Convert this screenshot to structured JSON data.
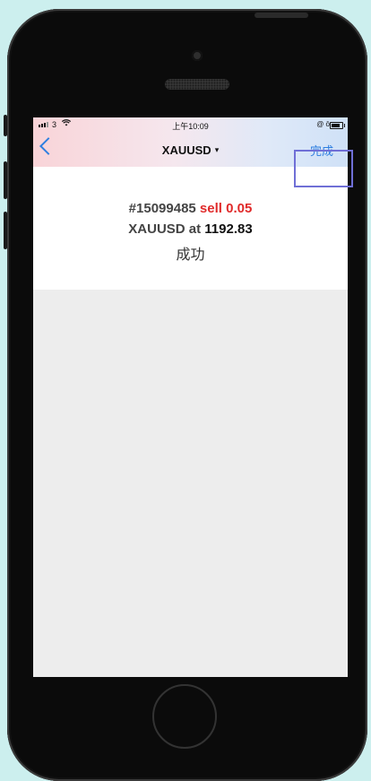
{
  "status_bar": {
    "carrier": "3",
    "time": "上午10:09",
    "right_icons": "@ ō"
  },
  "nav": {
    "title": "XAUUSD",
    "caret": "▾",
    "done_label": "完成"
  },
  "result": {
    "order_prefix": "#15099485 ",
    "side_amount": "sell 0.05",
    "symbol_at": "XAUUSD at ",
    "price": "1192.83",
    "status": "成功"
  },
  "colors": {
    "accent": "#2f7fe0",
    "sell": "#e02a2a",
    "highlight_box": "#6f6fd6"
  }
}
